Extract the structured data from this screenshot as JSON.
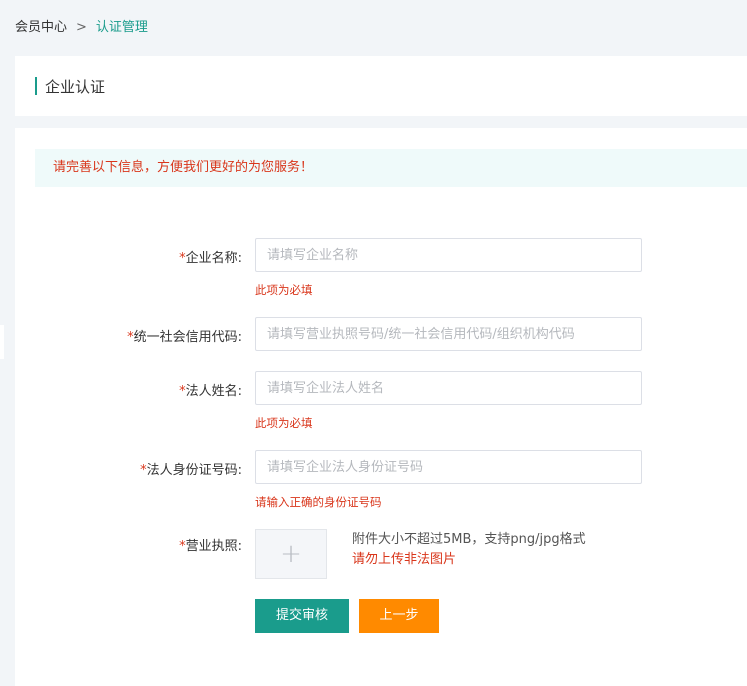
{
  "breadcrumb": {
    "root": "会员中心",
    "separator": ">",
    "current": "认证管理"
  },
  "section": {
    "title": "企业认证"
  },
  "notice": "请完善以下信息，方便我们更好的为您服务！",
  "form": {
    "required_mark": "*",
    "company_name": {
      "label": "企业名称:",
      "placeholder": "请填写企业名称",
      "value": "",
      "error": "此项为必填"
    },
    "credit_code": {
      "label": "统一社会信用代码:",
      "placeholder": "请填写营业执照号码/统一社会信用代码/组织机构代码",
      "value": ""
    },
    "legal_name": {
      "label": "法人姓名:",
      "placeholder": "请填写企业法人姓名",
      "value": "",
      "error": "此项为必填"
    },
    "legal_id": {
      "label": "法人身份证号码:",
      "placeholder": "请填写企业法人身份证号码",
      "value": "",
      "error": "请输入正确的身份证号码"
    },
    "license": {
      "label": "营业执照:",
      "upload_icon": "plus-icon",
      "hint_line1": "附件大小不超过5MB，支持png/jpg格式",
      "hint_line2": "请勿上传非法图片"
    }
  },
  "buttons": {
    "submit": "提交审核",
    "prev": "上一步"
  },
  "colors": {
    "accent": "#1a9c8c",
    "error": "#d9361b",
    "warning_button": "#ff8a00"
  }
}
